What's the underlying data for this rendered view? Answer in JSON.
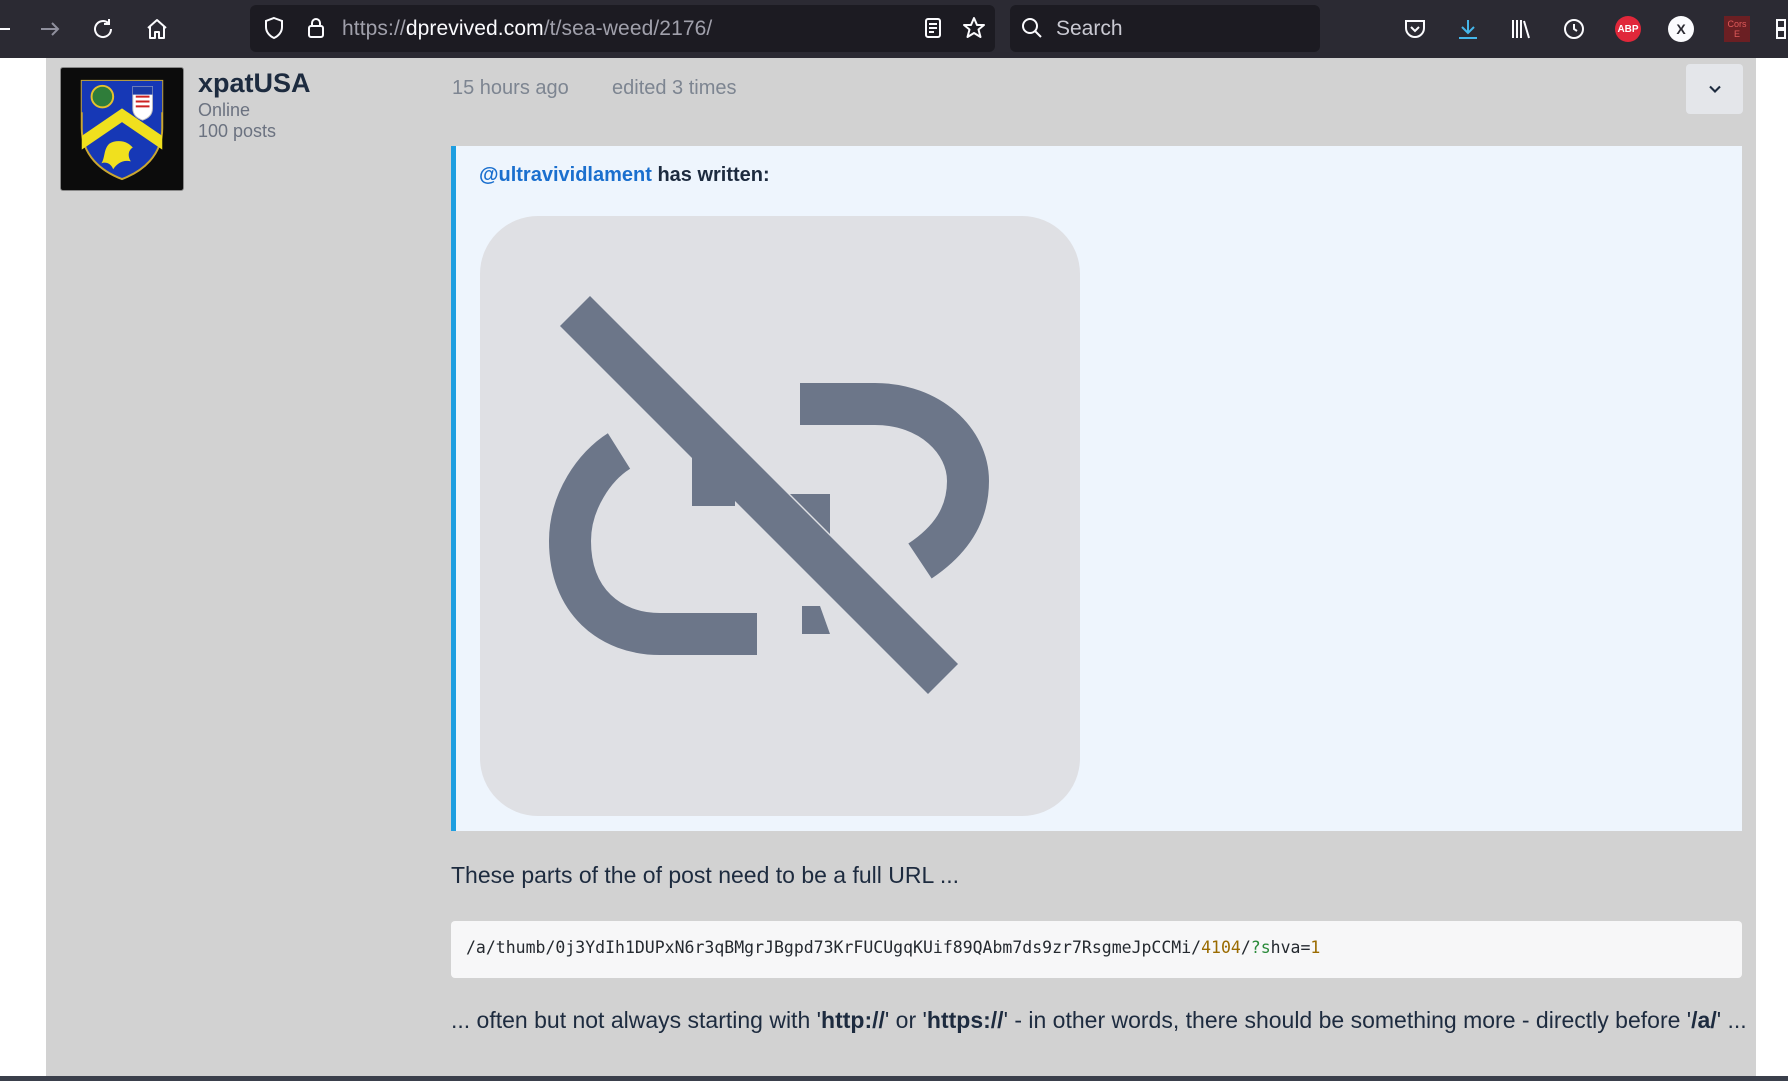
{
  "browser": {
    "url_prefix": "https://",
    "url_domain": "dprevived.com",
    "url_path": "/t/sea-weed/2176/",
    "search_placeholder": "Search",
    "extensions": {
      "abp": "ABP",
      "x": "X",
      "cors": "Cors E"
    }
  },
  "author": {
    "name": "xpatUSA",
    "status": "Online",
    "posts": "100 posts"
  },
  "post_meta": {
    "time": "15 hours ago",
    "edited": "edited 3 times"
  },
  "quote": {
    "mention": "@ultravividlament",
    "suffix": " has written:"
  },
  "body": {
    "para1": "These parts of the of post need to be a full URL ...",
    "code": {
      "path": "/a/thumb/0j3YdIh1DUPxN6r3qBMgrJBgpd73KrFUCUgqKUif89QAbm7ds9zr7RsgmeJpCCMi/",
      "num": "4104",
      "sep": "/",
      "q": "?s",
      "param": "hva=",
      "val": "1"
    },
    "para2": {
      "t1": "... often but not always starting with '",
      "b1": "http://",
      "t2": "' or '",
      "b2": "https://",
      "t3": "' - in other words, there should be something more - directly before '",
      "b3": "/a/",
      "t4": "' ..."
    }
  },
  "colors": {
    "toolbar": "#2b2a33",
    "quote_border": "#1e9ee0",
    "mention": "#1a6fce",
    "post_bg": "#d2d2d2"
  }
}
